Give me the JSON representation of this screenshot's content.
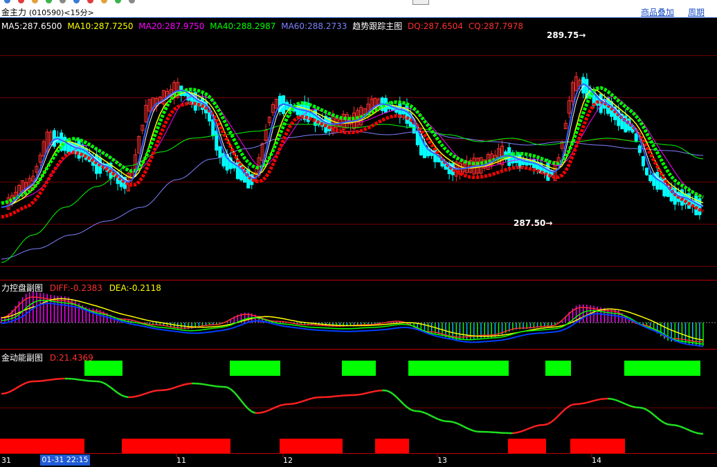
{
  "window": {
    "title": "金主力",
    "code": "(010590)",
    "period": "<15分>",
    "links": [
      "商品叠加",
      "周期"
    ]
  },
  "main_pane": {
    "indicators": [
      {
        "label": "MA5:287.6500",
        "color": "#ffffff"
      },
      {
        "label": "MA10:287.7250",
        "color": "#ffff00"
      },
      {
        "label": "MA20:287.9750",
        "color": "#ff00ff"
      },
      {
        "label": "MA40:288.2987",
        "color": "#00ff00"
      },
      {
        "label": "MA60:288.2733",
        "color": "#8080ff"
      },
      {
        "label": "趋势跟踪主图",
        "color": "#ffffff"
      },
      {
        "label": "DQ:287.6504",
        "color": "#ff3030"
      },
      {
        "label": "CQ:287.7978",
        "color": "#ff3030"
      }
    ],
    "high_flag": "289.75",
    "low_flag": "287.50"
  },
  "sub_pane_1": {
    "name": "力控盘副图",
    "values": [
      {
        "label": "DIFF:-0.2383",
        "color": "#ff3030"
      },
      {
        "label": "DEA:-0.2118",
        "color": "#ffff00"
      }
    ]
  },
  "sub_pane_2": {
    "name": "金动能副图",
    "values": [
      {
        "label": "D:21.4369",
        "color": "#ff3030"
      }
    ]
  },
  "x_axis": {
    "ticks": [
      "31",
      "11",
      "12",
      "13",
      "14"
    ],
    "cursor_label": "01-31 22:15"
  },
  "colors": {
    "up": "#ff3030",
    "down": "#00ffff",
    "grid": "#a00000",
    "green_band": "#00ff00",
    "red_band": "#ff0000"
  },
  "chart_data": [
    {
      "type": "line",
      "title": "金主力 (010590) 15分",
      "xlabel": "",
      "ylabel": "",
      "x": [
        "31",
        "11",
        "12",
        "13",
        "14"
      ],
      "ylim": [
        287.5,
        289.75
      ],
      "series": [
        {
          "name": "MA5",
          "values": [
            287.7,
            288.6,
            288.9,
            288.7,
            287.65
          ]
        },
        {
          "name": "MA10",
          "values": [
            287.8,
            288.5,
            288.8,
            288.65,
            287.73
          ]
        },
        {
          "name": "MA20",
          "values": [
            287.6,
            288.4,
            288.6,
            288.7,
            287.98
          ]
        },
        {
          "name": "MA40",
          "values": [
            287.3,
            288.0,
            288.4,
            288.5,
            288.3
          ]
        },
        {
          "name": "MA60",
          "values": [
            287.2,
            287.6,
            288.3,
            288.4,
            288.27
          ]
        }
      ]
    },
    {
      "type": "line",
      "x": [
        "31",
        "11",
        "12",
        "13",
        "14"
      ],
      "series": [
        {
          "name": "DIFF",
          "values": [
            0.35,
            0.05,
            0.12,
            -0.2,
            -0.24
          ]
        },
        {
          "name": "DEA",
          "values": [
            0.3,
            0.02,
            0.1,
            -0.15,
            -0.21
          ]
        }
      ]
    },
    {
      "type": "line",
      "x": [
        "31",
        "11",
        "12",
        "13",
        "14"
      ],
      "series": [
        {
          "name": "D",
          "values": [
            80,
            76,
            70,
            28,
            21.44
          ]
        }
      ]
    }
  ]
}
